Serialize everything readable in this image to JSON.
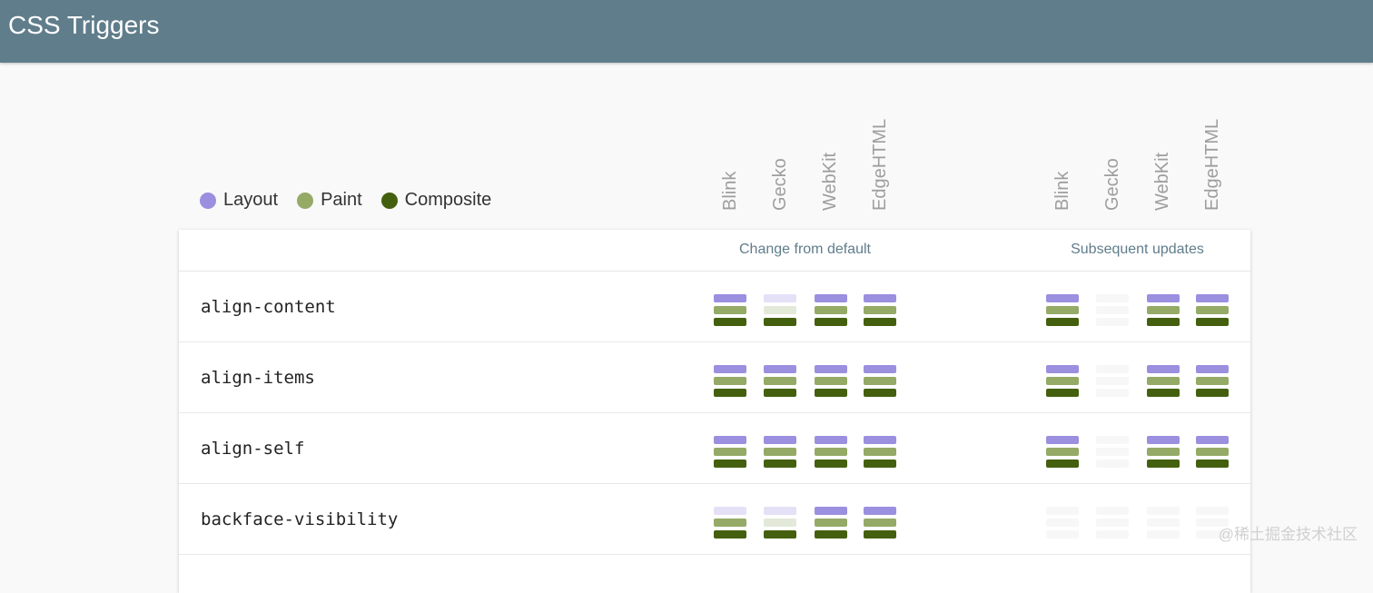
{
  "header": {
    "title": "CSS Triggers"
  },
  "legend": [
    {
      "label": "Layout",
      "color": "#9b8fe0"
    },
    {
      "label": "Paint",
      "color": "#94aa66"
    },
    {
      "label": "Composite",
      "color": "#44600f"
    }
  ],
  "engines": [
    "Blink",
    "Gecko",
    "WebKit",
    "EdgeHTML"
  ],
  "table": {
    "group_headers": [
      "Change from default",
      "Subsequent updates"
    ],
    "rows": [
      {
        "property": "align-content",
        "change_from_default": [
          {
            "layout": "on",
            "paint": "on",
            "composite": "on"
          },
          {
            "layout": "faint",
            "paint": "faint",
            "composite": "on"
          },
          {
            "layout": "on",
            "paint": "on",
            "composite": "on"
          },
          {
            "layout": "on",
            "paint": "on",
            "composite": "on"
          }
        ],
        "subsequent_updates": [
          {
            "layout": "on",
            "paint": "on",
            "composite": "on"
          },
          {
            "layout": "blank",
            "paint": "blank",
            "composite": "blank"
          },
          {
            "layout": "on",
            "paint": "on",
            "composite": "on"
          },
          {
            "layout": "on",
            "paint": "on",
            "composite": "on"
          }
        ]
      },
      {
        "property": "align-items",
        "change_from_default": [
          {
            "layout": "on",
            "paint": "on",
            "composite": "on"
          },
          {
            "layout": "on",
            "paint": "on",
            "composite": "on"
          },
          {
            "layout": "on",
            "paint": "on",
            "composite": "on"
          },
          {
            "layout": "on",
            "paint": "on",
            "composite": "on"
          }
        ],
        "subsequent_updates": [
          {
            "layout": "on",
            "paint": "on",
            "composite": "on"
          },
          {
            "layout": "blank",
            "paint": "blank",
            "composite": "blank"
          },
          {
            "layout": "on",
            "paint": "on",
            "composite": "on"
          },
          {
            "layout": "on",
            "paint": "on",
            "composite": "on"
          }
        ]
      },
      {
        "property": "align-self",
        "change_from_default": [
          {
            "layout": "on",
            "paint": "on",
            "composite": "on"
          },
          {
            "layout": "on",
            "paint": "on",
            "composite": "on"
          },
          {
            "layout": "on",
            "paint": "on",
            "composite": "on"
          },
          {
            "layout": "on",
            "paint": "on",
            "composite": "on"
          }
        ],
        "subsequent_updates": [
          {
            "layout": "on",
            "paint": "on",
            "composite": "on"
          },
          {
            "layout": "blank",
            "paint": "blank",
            "composite": "blank"
          },
          {
            "layout": "on",
            "paint": "on",
            "composite": "on"
          },
          {
            "layout": "on",
            "paint": "on",
            "composite": "on"
          }
        ]
      },
      {
        "property": "backface-visibility",
        "change_from_default": [
          {
            "layout": "faint",
            "paint": "on",
            "composite": "on"
          },
          {
            "layout": "faint",
            "paint": "faint",
            "composite": "on"
          },
          {
            "layout": "on",
            "paint": "on",
            "composite": "on"
          },
          {
            "layout": "on",
            "paint": "on",
            "composite": "on"
          }
        ],
        "subsequent_updates": [
          {
            "layout": "blank",
            "paint": "blank",
            "composite": "blank"
          },
          {
            "layout": "blank",
            "paint": "blank",
            "composite": "blank"
          },
          {
            "layout": "blank",
            "paint": "blank",
            "composite": "blank"
          },
          {
            "layout": "blank",
            "paint": "blank",
            "composite": "blank"
          }
        ]
      }
    ]
  },
  "colors": {
    "layout_on": "#9b8fe0",
    "layout_faint": "#e4e1f7",
    "paint_on": "#94aa66",
    "paint_faint": "#e3e9d9",
    "composite_on": "#44600f",
    "composite_faint": "#c5cfb4",
    "blank": "#f7f7f7"
  },
  "watermark": "@稀土掘金技术社区"
}
